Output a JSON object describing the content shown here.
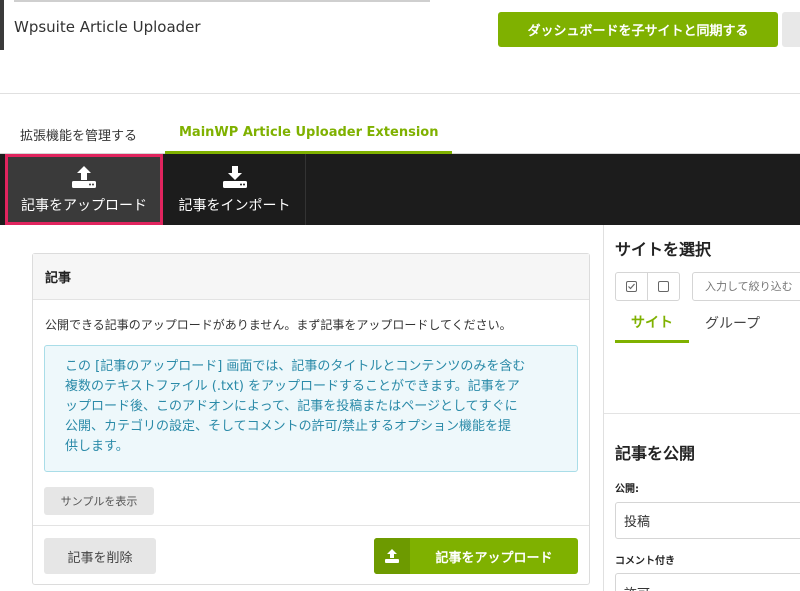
{
  "header": {
    "site_title": "Wpsuite Article Uploader",
    "sync_button_label": "ダッシュボードを子サイトと同期する"
  },
  "tabs": [
    {
      "label": "拡張機能を管理する",
      "active": false
    },
    {
      "label": "MainWP Article Uploader Extension",
      "active": true
    }
  ],
  "toolbar": {
    "items": [
      {
        "label": "記事をアップロード",
        "icon": "upload-icon",
        "active": true
      },
      {
        "label": "記事をインポート",
        "icon": "download-icon",
        "active": false
      }
    ]
  },
  "articles_card": {
    "title": "記事",
    "empty_message": "公開できる記事のアップロードがありません。まず記事をアップロードしてください。",
    "info_lines": [
      "この [記事のアップロード] 画面では、記事のタイトルとコンテンツのみを含む",
      "複数のテキストファイル (.txt) をアップロードすることができます。記事をア",
      "ップロード後、このアドオンによって、記事を投稿またはページとしてすぐに",
      "公開、カテゴリの設定、そしてコメントの許可/禁止するオプション機能を提",
      "供します。"
    ],
    "sample_button_label": "サンプルを表示",
    "delete_button_label": "記事を削除",
    "upload_button_label": "記事をアップロード"
  },
  "site_panel": {
    "title": "サイトを選択",
    "filter_placeholder": "入力して絞り込む",
    "subtabs": [
      {
        "label": "サイト",
        "active": true
      },
      {
        "label": "グループ",
        "active": false
      }
    ]
  },
  "publish_panel": {
    "title": "記事を公開",
    "public_label": "公開:",
    "public_value": "投稿",
    "comment_label": "コメント付き",
    "comment_value": "許可"
  },
  "colors": {
    "accent": "#7fb100",
    "toolbar_bg": "#1c1c1c",
    "highlight_border": "#e0245e",
    "info_text": "#2a8aa8"
  }
}
